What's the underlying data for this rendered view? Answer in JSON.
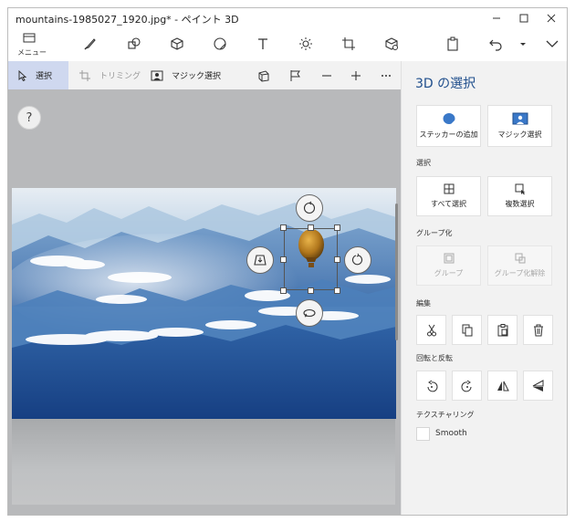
{
  "window": {
    "title": "mountains-1985027_1920.jpg* - ペイント 3D"
  },
  "toolbar": {
    "menu_label": "メニュー",
    "tools": [
      "menu-icon",
      "brush-icon",
      "2d-shapes-icon",
      "3d-shapes-icon",
      "stickers-icon",
      "text-icon",
      "effects-icon",
      "canvas-icon",
      "3d-library-icon",
      "paste-icon",
      "undo-icon",
      "more-chevron-icon",
      "expand-chevron-icon"
    ]
  },
  "subtoolbar": {
    "select_label": "選択",
    "crop_label": "トリミング",
    "magic_select_label": "マジック選択"
  },
  "canvas": {
    "help_label": "?"
  },
  "panel": {
    "title": "3D の選択",
    "sticker_add_label": "ステッカーの追加",
    "magic_select_label": "マジック選択",
    "select_section": "選択",
    "select_all_label": "すべて選択",
    "multi_select_label": "複数選択",
    "group_section": "グループ化",
    "group_label": "グループ",
    "ungroup_label": "グループ化解除",
    "edit_section": "編集",
    "rotate_section": "回転と反転",
    "texture_section": "テクスチャリング",
    "smooth_label": "Smooth"
  },
  "colors": {
    "accent_title": "#1f4e8c",
    "active_tool_bg": "#cfd8ef",
    "panel_bg": "#f2f2f2"
  }
}
